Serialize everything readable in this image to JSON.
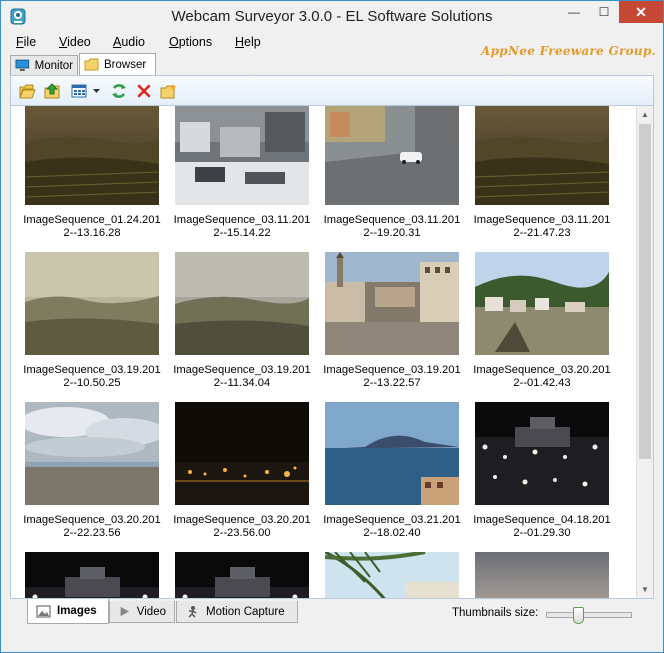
{
  "window": {
    "title": "Webcam Surveyor 3.0.0 - EL Software Solutions",
    "close_glyph": "✕",
    "minimize_glyph": "—",
    "maximize_glyph": "☐"
  },
  "watermark": "AppNee Freeware Group.",
  "menu": [
    {
      "label": "File",
      "key": "F",
      "rest": "ile"
    },
    {
      "label": "Video",
      "key": "V",
      "rest": "ideo"
    },
    {
      "label": "Audio",
      "key": "A",
      "rest": "udio"
    },
    {
      "label": "Options",
      "key": "O",
      "rest": "ptions"
    },
    {
      "label": "Help",
      "key": "H",
      "rest": "elp"
    }
  ],
  "top_tabs": {
    "monitor": "Monitor",
    "browser": "Browser",
    "active": "Browser"
  },
  "toolbar": {
    "icons": [
      "open-folder-icon",
      "up-folder-icon",
      "view-mode-icon",
      "dropdown-arrow-icon",
      "refresh-icon",
      "delete-icon",
      "new-folder-icon"
    ]
  },
  "thumbnails": [
    {
      "line1": "ImageSequence_01.24.201",
      "line2": "2--13.16.28",
      "scene": "vineyard-dusk"
    },
    {
      "line1": "ImageSequence_03.11.201",
      "line2": "2--15.14.22",
      "scene": "snowy-town"
    },
    {
      "line1": "ImageSequence_03.11.201",
      "line2": "2--19.20.31",
      "scene": "street-car"
    },
    {
      "line1": "ImageSequence_03.11.201",
      "line2": "2--21.47.23",
      "scene": "vineyard-dusk"
    },
    {
      "line1": "ImageSequence_03.19.201",
      "line2": "2--10.50.25",
      "scene": "foggy-hills"
    },
    {
      "line1": "ImageSequence_03.19.201",
      "line2": "2--11.34.04",
      "scene": "foggy-hills-2"
    },
    {
      "line1": "ImageSequence_03.19.201",
      "line2": "2--13.22.57",
      "scene": "town-square"
    },
    {
      "line1": "ImageSequence_03.20.201",
      "line2": "2--01.42.43",
      "scene": "village-valley"
    },
    {
      "line1": "ImageSequence_03.20.201",
      "line2": "2--22.23.56",
      "scene": "cloudy-coast"
    },
    {
      "line1": "ImageSequence_03.20.201",
      "line2": "2--23.56.00",
      "scene": "night-city"
    },
    {
      "line1": "ImageSequence_03.21.201",
      "line2": "2--18.02.40",
      "scene": "sea-mountain"
    },
    {
      "line1": "ImageSequence_04.18.201",
      "line2": "2--01.29.30",
      "scene": "night-square"
    },
    {
      "line1": "",
      "line2": "",
      "scene": "night-square"
    },
    {
      "line1": "",
      "line2": "",
      "scene": "night-square"
    },
    {
      "line1": "",
      "line2": "",
      "scene": "resort-pool"
    },
    {
      "line1": "",
      "line2": "",
      "scene": "dusk-hills"
    }
  ],
  "bottom_tabs": {
    "images": "Images",
    "video": "Video",
    "motion": "Motion Capture",
    "active": "Images"
  },
  "thumbnails_size": {
    "label": "Thumbnails size:",
    "level": 0.35
  },
  "colors": {
    "accent_border": "#3c8fcf",
    "close_button": "#c74735",
    "watermark": "#e39a28"
  }
}
